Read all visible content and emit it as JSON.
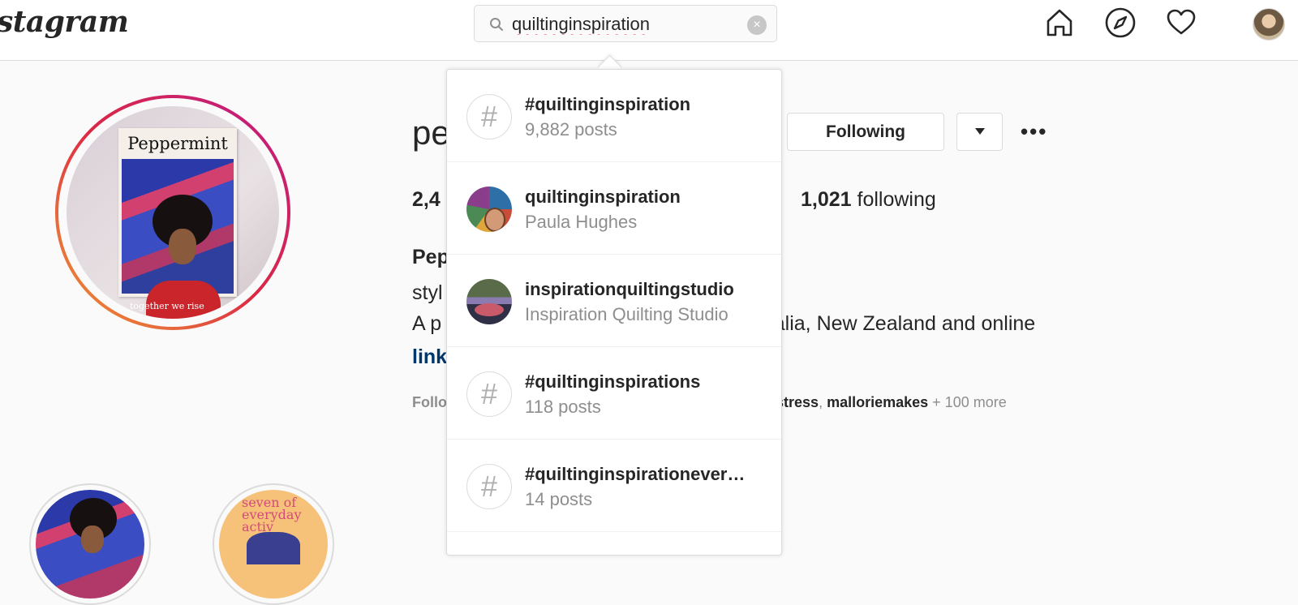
{
  "app": {
    "logo_text": "stagram"
  },
  "search": {
    "value": "quiltinginspiration",
    "clear_label": "×"
  },
  "nav": {
    "icons": [
      "home-icon",
      "explore-compass-icon",
      "activity-heart-icon",
      "profile-avatar"
    ]
  },
  "profile": {
    "username": "pe",
    "following_button": "Following",
    "more_label": "•••",
    "stats_posts_partial": "2,4",
    "following_count": "1,021",
    "following_label": "following",
    "bio_name_partial": "Pep",
    "bio_category_partial": "styl",
    "bio_line_start": "A p",
    "bio_line_rest": "stralia, New Zealand and online",
    "bio_link_partial": "link",
    "followed_by_partial": "Follo",
    "followed_by_rest_a": "amstress",
    "followed_by_rest_b": "malloriemakes",
    "followed_by_more": "+ 100 more",
    "avatar_cover_title": "Peppermint",
    "avatar_cover_tagline": "together we rise",
    "highlight2_text": "seven of everyday activ"
  },
  "search_results": [
    {
      "type": "hashtag",
      "title": "#quiltinginspiration",
      "subtitle": "9,882 posts"
    },
    {
      "type": "user",
      "title": "quiltinginspiration",
      "subtitle": "Paula Hughes"
    },
    {
      "type": "user",
      "title": "inspirationquiltingstudio",
      "subtitle": "Inspiration Quilting Studio"
    },
    {
      "type": "hashtag",
      "title": "#quiltinginspirations",
      "subtitle": "118 posts"
    },
    {
      "type": "hashtag",
      "title": "#quiltinginspirationever…",
      "subtitle": "14 posts"
    }
  ],
  "colors": {
    "link": "#00376b",
    "muted": "#8e8e8e",
    "border": "#dbdbdb",
    "text": "#262626"
  }
}
